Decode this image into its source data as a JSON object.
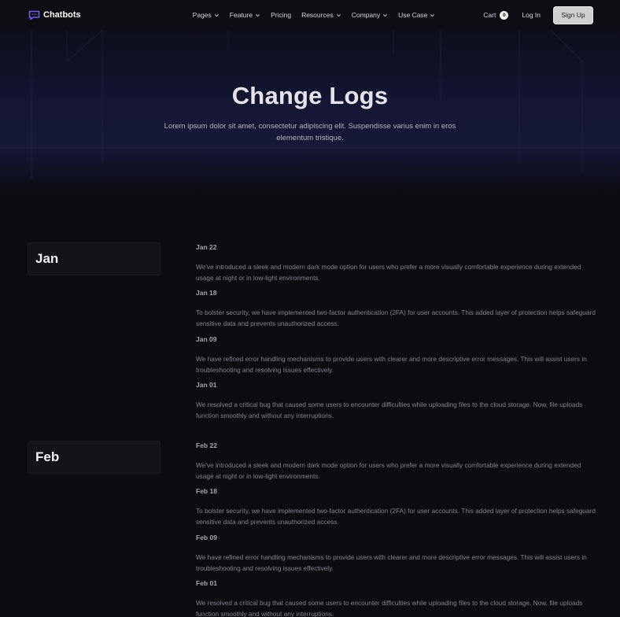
{
  "nav": {
    "brand": "Chatbots",
    "menu": [
      {
        "label": "Pages",
        "dropdown": true
      },
      {
        "label": "Feature",
        "dropdown": true
      },
      {
        "label": "Pricing",
        "dropdown": false
      },
      {
        "label": "Resources",
        "dropdown": true
      },
      {
        "label": "Company",
        "dropdown": true
      },
      {
        "label": "Use Case",
        "dropdown": true
      }
    ],
    "cart_label": "Cart",
    "cart_count": "0",
    "login": "Log In",
    "signup": "Sign Up"
  },
  "hero": {
    "title": "Change Logs",
    "subtitle": "Lorem ipsum dolor sit amet, consectetur adipiscing elit. Suspendisse varius enim in eros elementum tristique."
  },
  "months": [
    {
      "name": "Jan",
      "entries": [
        {
          "date": "Jan 22",
          "text": "We've introduced a sleek and modern dark mode option for users who prefer a more visually comfortable experience during extended usage at night or in low-light environments."
        },
        {
          "date": "Jan 18",
          "text": "To bolster security, we have implemented two-factor authentication (2FA) for user accounts. This added layer of protection helps safeguard sensitive data and prevents unauthorized access."
        },
        {
          "date": "Jan 09",
          "text": "We have refined error handling mechanisms to provide users with clearer and more descriptive error messages. This will assist users in troubleshooting and resolving issues effectively."
        },
        {
          "date": "Jan 01",
          "text": "We resolved a critical bug that caused some users to encounter difficulties while uploading files to the cloud storage. Now, file uploads function smoothly and without any interruptions."
        }
      ]
    },
    {
      "name": "Feb",
      "entries": [
        {
          "date": "Feb 22",
          "text": "We've introduced a sleek and modern dark mode option for users who prefer a more visually comfortable experience during extended usage at night or in low-light environments."
        },
        {
          "date": "Feb 18",
          "text": "To bolster security, we have implemented two-factor authentication (2FA) for user accounts. This added layer of protection helps safeguard sensitive data and prevents unauthorized access."
        },
        {
          "date": "Feb 09",
          "text": "We have refined error handling mechanisms to provide users with clearer and more descriptive error messages. This will assist users in troubleshooting and resolving issues effectively."
        },
        {
          "date": "Feb 01",
          "text": "We resolved a critical bug that caused some users to encounter difficulties while uploading files to the cloud storage. Now, file uploads function smoothly and without any interruptions."
        }
      ]
    }
  ],
  "colors": {
    "background": "#0b0b10",
    "hero_glow": "#161838",
    "brand_icon": "#6b5cff",
    "signup_bg": "#cfcfd1"
  },
  "icons": {
    "brand": "chat-bubble-icon",
    "dropdown": "chevron-down-icon"
  }
}
